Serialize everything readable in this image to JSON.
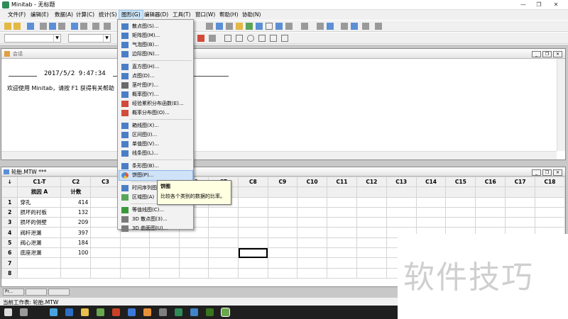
{
  "window": {
    "title": "Minitab - 无标题"
  },
  "menubar": {
    "items": [
      "文件(F)",
      "编辑(E)",
      "数据(A)",
      "计算(C)",
      "统计(S)",
      "图形(G)",
      "编辑器(D)",
      "工具(T)",
      "窗口(W)",
      "帮助(H)",
      "协助(N)"
    ]
  },
  "session": {
    "title": "会话",
    "datetime": "2017/5/2 9:47:34",
    "welcome": "欢迎使用 Minitab，请按 F1 获得有关帮助"
  },
  "worksheet": {
    "title": "轮胎.MTW ***",
    "corner": "↓",
    "columns": [
      "C1-T",
      "C2",
      "C3",
      "C4",
      "C5",
      "C6",
      "C7",
      "C8",
      "C9",
      "C10",
      "C11",
      "C12",
      "C13",
      "C14",
      "C15",
      "C16",
      "C17",
      "C18"
    ],
    "column_names": [
      "损因 A",
      "计数"
    ],
    "rows": [
      {
        "n": "1",
        "c1": "穿孔",
        "c2": "414"
      },
      {
        "n": "2",
        "c1": "损坏的衬板",
        "c2": "132"
      },
      {
        "n": "3",
        "c1": "损坏的侧壁",
        "c2": "209"
      },
      {
        "n": "4",
        "c1": "阀杆泄漏",
        "c2": "397"
      },
      {
        "n": "5",
        "c1": "阀心泄漏",
        "c2": "184"
      },
      {
        "n": "6",
        "c1": "底座泄漏",
        "c2": "100"
      },
      {
        "n": "7",
        "c1": "",
        "c2": ""
      },
      {
        "n": "8",
        "c1": "",
        "c2": ""
      }
    ]
  },
  "graph_menu": {
    "items": [
      {
        "label": "散点图(S)...",
        "icon": "scatterplot-icon"
      },
      {
        "label": "矩阵图(M)...",
        "icon": "matrix-plot-icon"
      },
      {
        "label": "气泡图(B)...",
        "icon": "bubble-plot-icon"
      },
      {
        "label": "边际图(N)...",
        "icon": "marginal-plot-icon"
      },
      {
        "label": "直方图(H)...",
        "icon": "histogram-icon"
      },
      {
        "label": "点图(D)...",
        "icon": "dotplot-icon"
      },
      {
        "label": "茎叶图(F)...",
        "icon": "stem-leaf-icon"
      },
      {
        "label": "概率图(Y)...",
        "icon": "probability-plot-icon"
      },
      {
        "label": "经验累积分布函数(E)...",
        "icon": "ecdf-icon"
      },
      {
        "label": "概率分布图(O)...",
        "icon": "probability-distribution-icon"
      },
      {
        "label": "箱线图(X)...",
        "icon": "boxplot-icon"
      },
      {
        "label": "区间图(I)...",
        "icon": "interval-plot-icon"
      },
      {
        "label": "单值图(V)...",
        "icon": "individual-value-icon"
      },
      {
        "label": "线条图(L)...",
        "icon": "line-plot-icon"
      },
      {
        "label": "条形图(B)...",
        "icon": "bar-chart-icon"
      },
      {
        "label": "饼图(P)...",
        "icon": "pie-chart-icon"
      },
      {
        "label": "时间序列图",
        "icon": "time-series-icon"
      },
      {
        "label": "区域图(A)",
        "icon": "area-graph-icon"
      },
      {
        "label": "等值线图(C)...",
        "icon": "contour-plot-icon"
      },
      {
        "label": "3D 散点图(3)...",
        "icon": "3d-scatter-icon"
      },
      {
        "label": "3D 曲面图(U)...",
        "icon": "3d-surface-icon"
      }
    ]
  },
  "tooltip": {
    "title": "饼图",
    "description": "比较各个类别的数据的比率。"
  },
  "statusbar": {
    "text": "当前工作表: 轮胎.MTW"
  },
  "minimized": [
    "Pr...",
    "",
    ""
  ],
  "watermark": {
    "text": "软件技巧"
  },
  "colors": {
    "menu_highlight": "#cfe3f8",
    "tooltip_bg": "#ffffe1",
    "mdi_bg": "#c8c8c8",
    "taskbar": "#1f1f1f"
  }
}
